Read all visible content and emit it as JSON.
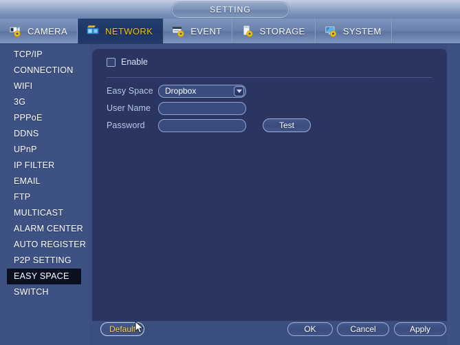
{
  "window": {
    "title": "SETTING"
  },
  "tabs": [
    {
      "label": "CAMERA",
      "icon": "camera-gear-icon",
      "active": false
    },
    {
      "label": "NETWORK",
      "icon": "network-boxes-icon",
      "active": true
    },
    {
      "label": "EVENT",
      "icon": "event-gear-icon",
      "active": false
    },
    {
      "label": "STORAGE",
      "icon": "storage-gear-icon",
      "active": false
    },
    {
      "label": "SYSTEM",
      "icon": "system-gear-icon",
      "active": false
    }
  ],
  "sidebar": {
    "items": [
      {
        "label": "TCP/IP",
        "selected": false
      },
      {
        "label": "CONNECTION",
        "selected": false
      },
      {
        "label": "WIFI",
        "selected": false
      },
      {
        "label": "3G",
        "selected": false
      },
      {
        "label": "PPPoE",
        "selected": false
      },
      {
        "label": "DDNS",
        "selected": false
      },
      {
        "label": "UPnP",
        "selected": false
      },
      {
        "label": "IP FILTER",
        "selected": false
      },
      {
        "label": "EMAIL",
        "selected": false
      },
      {
        "label": "FTP",
        "selected": false
      },
      {
        "label": "MULTICAST",
        "selected": false
      },
      {
        "label": "ALARM CENTER",
        "selected": false
      },
      {
        "label": "AUTO REGISTER",
        "selected": false
      },
      {
        "label": "P2P SETTING",
        "selected": false
      },
      {
        "label": "EASY SPACE",
        "selected": true
      },
      {
        "label": "SWITCH",
        "selected": false
      }
    ]
  },
  "form": {
    "enable": {
      "label": "Enable",
      "checked": false
    },
    "easy_space": {
      "label": "Easy Space",
      "value": "Dropbox",
      "options": [
        "Dropbox"
      ]
    },
    "user_name": {
      "label": "User Name",
      "value": "",
      "placeholder": ""
    },
    "password": {
      "label": "Password",
      "value": "",
      "placeholder": ""
    },
    "test_button": "Test"
  },
  "footer": {
    "default_label": "Default",
    "ok_label": "OK",
    "cancel_label": "Cancel",
    "apply_label": "Apply"
  },
  "colors": {
    "title_bar": "#9fb2d0",
    "tab_bar": "#6b83ad",
    "active_tab_bg": "#1e3666",
    "active_tab_text": "#f5c400",
    "sidebar_bg": "#3d5182",
    "selected_item_bg": "#0b1020",
    "panel_bg": "#2a3661",
    "window_bg": "#3a4f7d",
    "highlight_text": "#ffd23a"
  }
}
